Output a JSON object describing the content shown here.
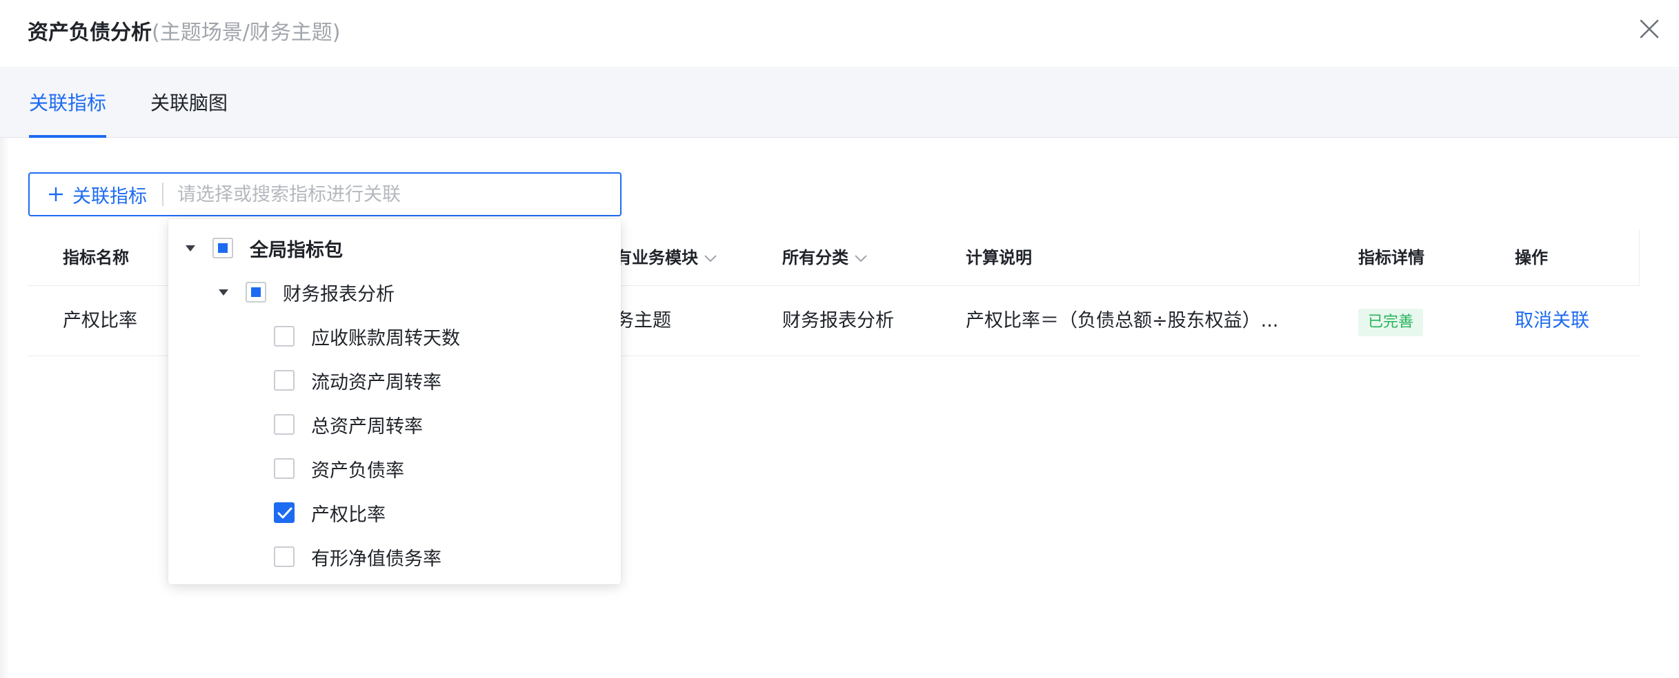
{
  "header": {
    "title": "资产负债分析",
    "subtitle": "(主题场景/财务主题)"
  },
  "tabs": [
    {
      "label": "关联指标",
      "active": true
    },
    {
      "label": "关联脑图",
      "active": false
    }
  ],
  "search": {
    "button_label": "关联指标",
    "placeholder": "请选择或搜索指标进行关联",
    "value": ""
  },
  "table": {
    "columns": [
      "指标名称",
      "有业务模块",
      "所有分类",
      "计算说明",
      "指标详情",
      "操作"
    ],
    "rows": [
      {
        "name": "产权比率",
        "module": "务主题",
        "category": "财务报表分析",
        "calc": "产权比率＝（负债总额÷股东权益）...",
        "status": "已完善",
        "action": "取消关联"
      }
    ]
  },
  "tree": {
    "root": {
      "label": "全局指标包",
      "state": "partial",
      "expanded": true
    },
    "group": {
      "label": "财务报表分析",
      "state": "partial",
      "expanded": true
    },
    "leaves": [
      {
        "label": "应收账款周转天数",
        "checked": false
      },
      {
        "label": "流动资产周转率",
        "checked": false
      },
      {
        "label": "总资产周转率",
        "checked": false
      },
      {
        "label": "资产负债率",
        "checked": false
      },
      {
        "label": "产权比率",
        "checked": true
      },
      {
        "label": "有形净值债务率",
        "checked": false
      }
    ]
  },
  "colors": {
    "primary": "#1d6bf1",
    "success_text": "#27b35a",
    "success_bg": "#e8f8ee",
    "tab_bar_bg": "#f4f6f9"
  }
}
